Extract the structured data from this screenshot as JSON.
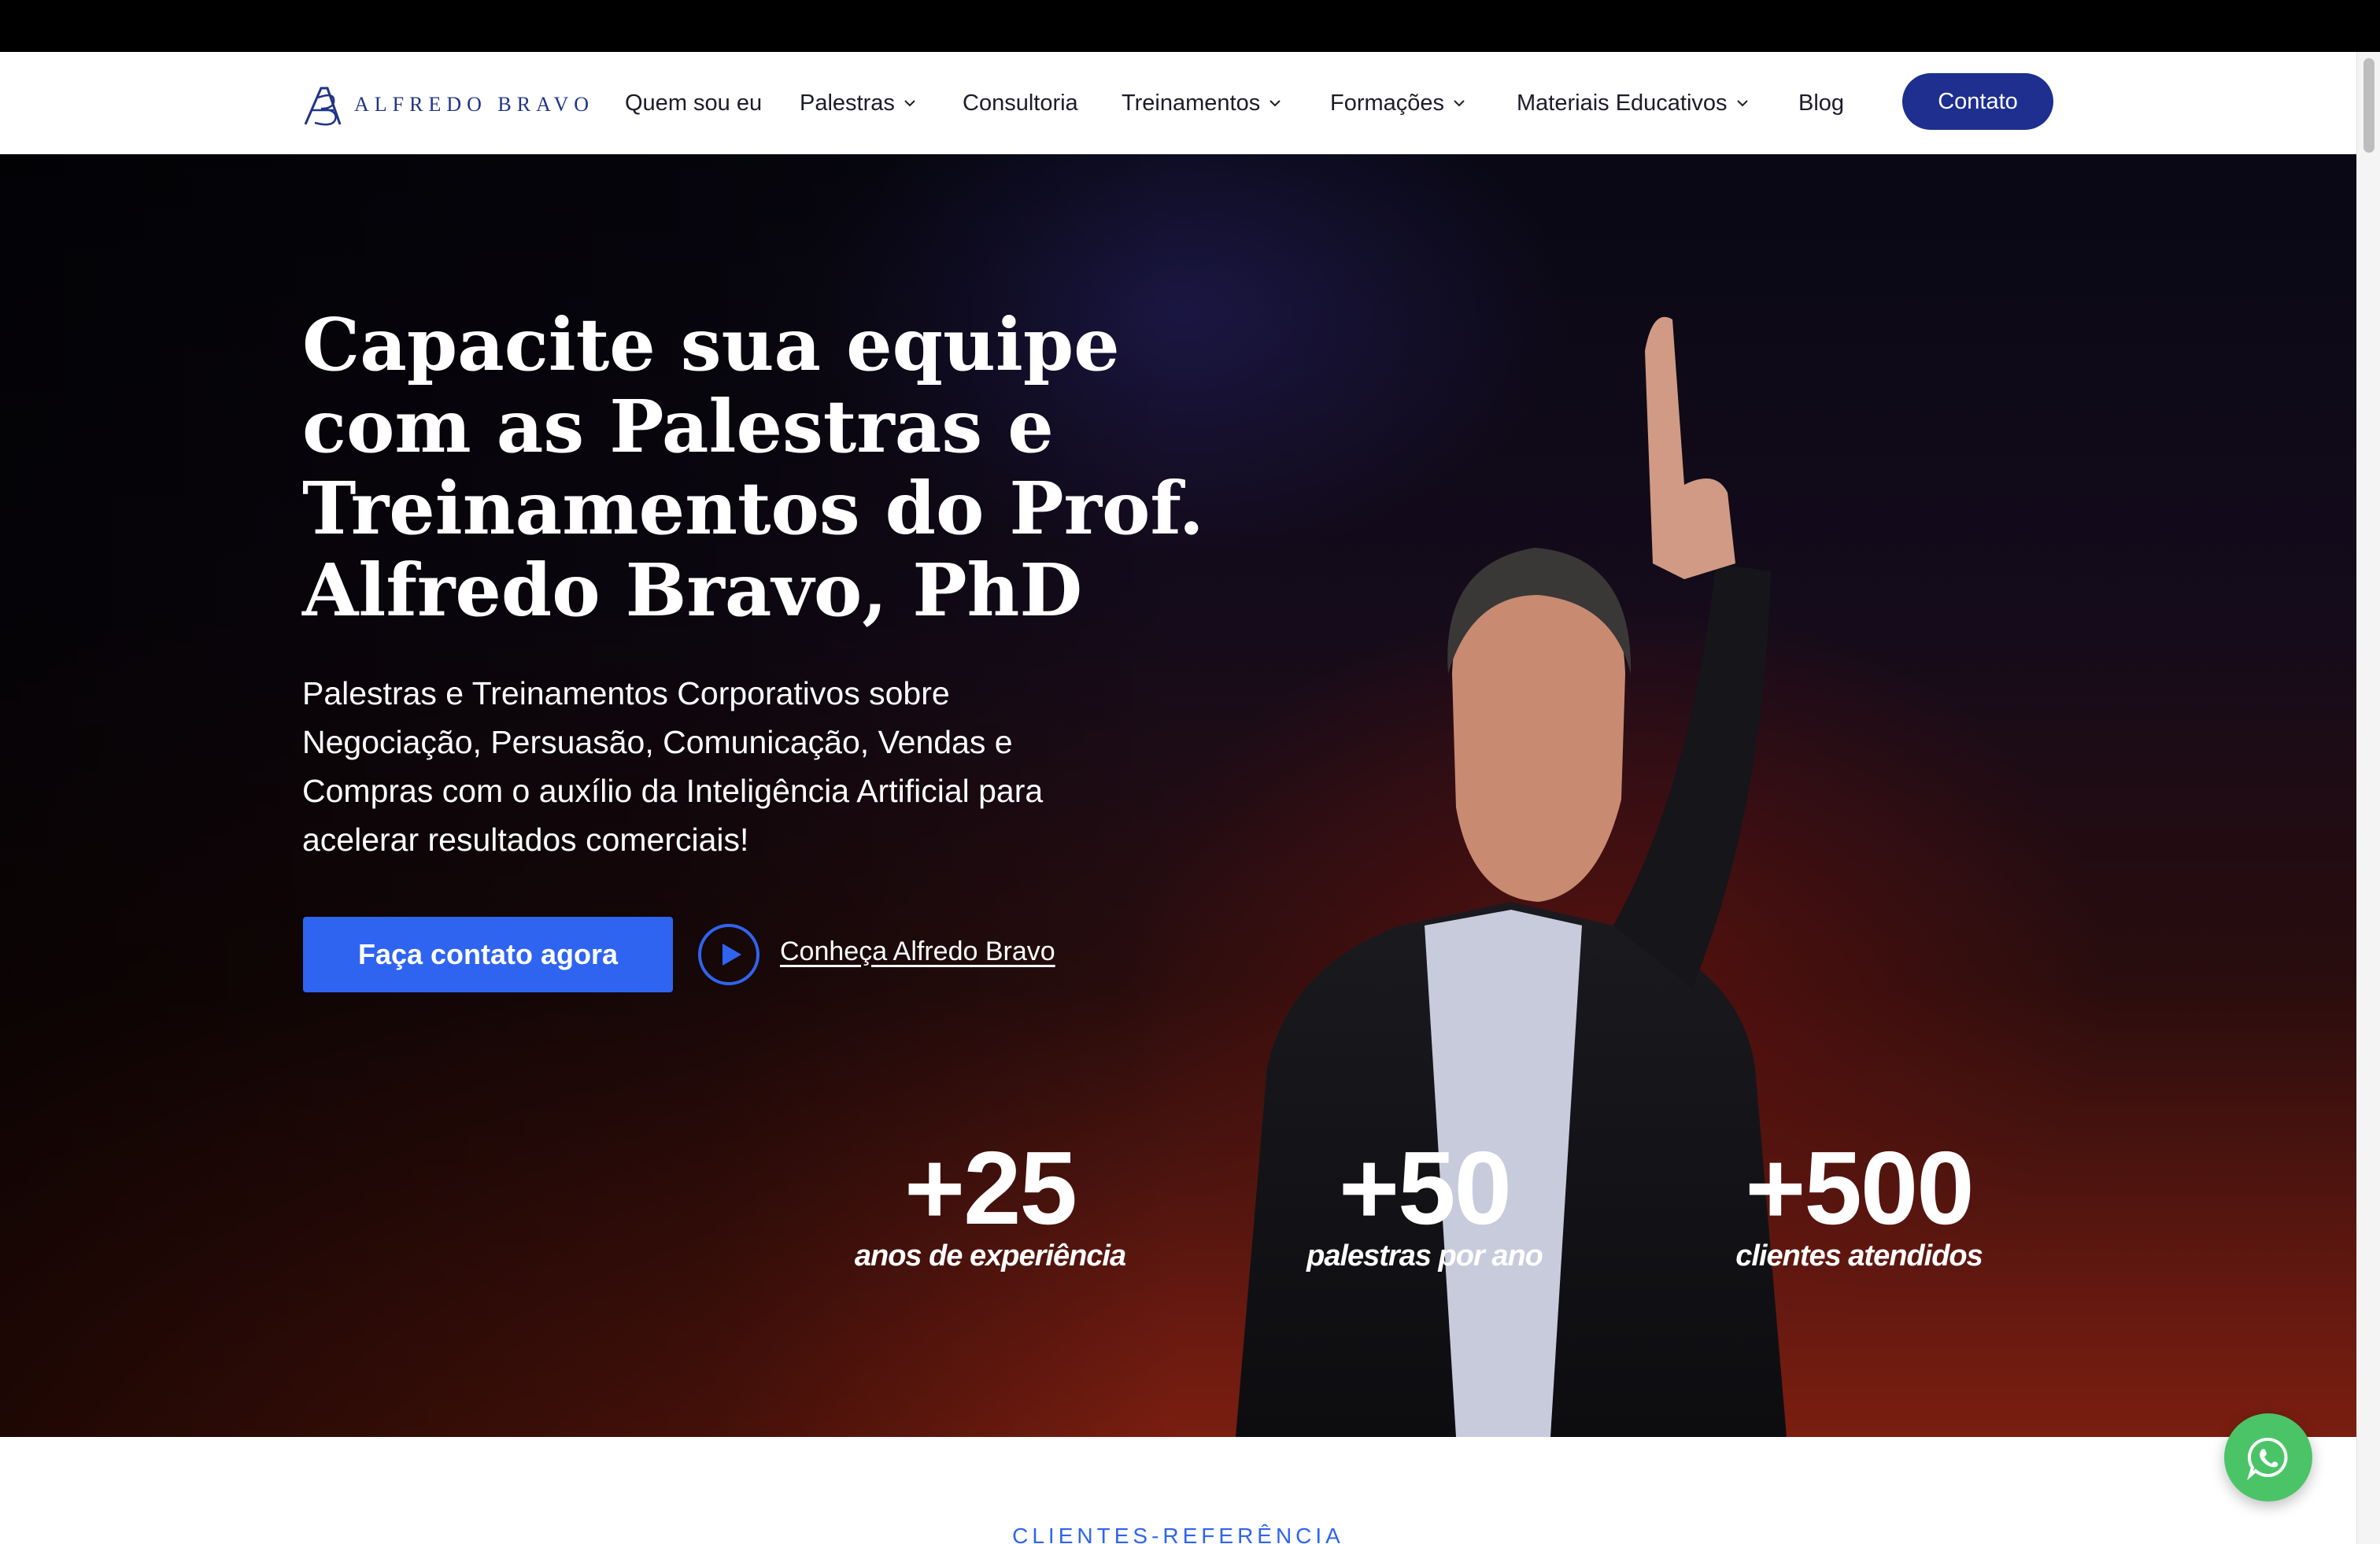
{
  "brand": {
    "name": "ALFREDO BRAVO",
    "color": "#1f3488"
  },
  "nav": {
    "items": [
      {
        "label": "Quem sou eu",
        "dropdown": false
      },
      {
        "label": "Palestras",
        "dropdown": true
      },
      {
        "label": "Consultoria",
        "dropdown": false
      },
      {
        "label": "Treinamentos",
        "dropdown": true
      },
      {
        "label": "Formações",
        "dropdown": true
      },
      {
        "label": "Materiais Educativos",
        "dropdown": true
      },
      {
        "label": "Blog",
        "dropdown": false
      }
    ],
    "contact_label": "Contato",
    "contact_color": "#1e2f8f"
  },
  "hero": {
    "title": "Capacite sua equipe com as Palestras e Treinamentos do Prof. Alfredo Bravo, PhD",
    "subtitle": "Palestras e Treinamentos Corporativos sobre Negociação, Persuasão, Comunicação, Vendas e Compras com o auxílio da Inteligência Artificial para acelerar resultados comerciais!",
    "cta_label": "Faça contato agora",
    "cta_color": "#2f64f0",
    "video_link_label": "Conheça Alfredo Bravo",
    "play_icon": "play-circle-icon"
  },
  "stats": [
    {
      "number": "+25",
      "label": "anos de experiência"
    },
    {
      "number": "+50",
      "label": "palestras por ano"
    },
    {
      "number": "+500",
      "label": "clientes atendidos"
    }
  ],
  "clients_section": {
    "label": "CLIENTES-REFERÊNCIA"
  },
  "whatsapp": {
    "icon": "whatsapp-icon",
    "color": "#4bc467"
  }
}
